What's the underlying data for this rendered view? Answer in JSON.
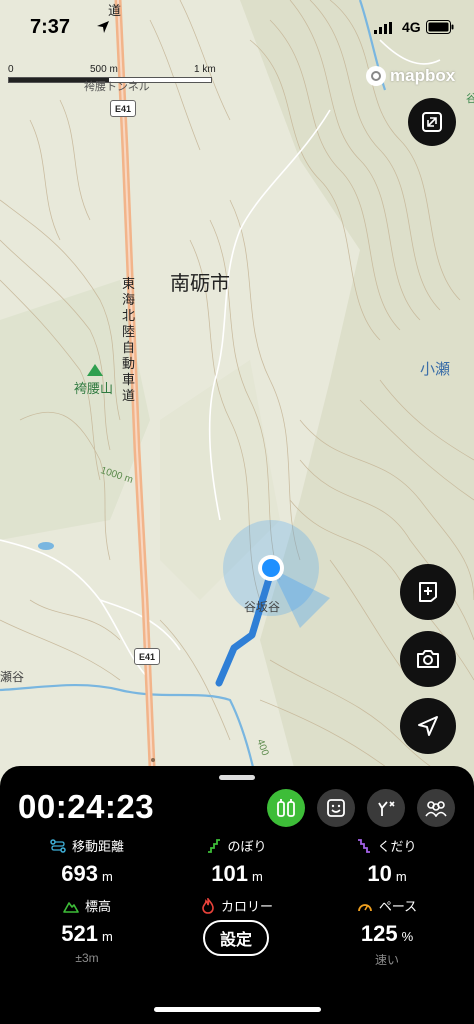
{
  "status_bar": {
    "time": "7:37",
    "network": "4G"
  },
  "map": {
    "scale_labels": [
      "0",
      "500 m",
      "1 km"
    ],
    "attribution": "mapbox",
    "places": {
      "city": "南砺市",
      "expressway_name": "東海北陸自動車道",
      "mountain": "袴腰山",
      "tunnel": "袴腰トンネル",
      "route_top": "道",
      "kose": "小瀬",
      "valley": "谷",
      "valley_label": "谷坂谷",
      "settlement_left": "瀬谷"
    },
    "road_shields": [
      "E41",
      "E41"
    ],
    "contour_labels": [
      "1000 m",
      "400"
    ]
  },
  "tracker": {
    "elapsed": "00:24:23",
    "modes": [
      "hiking-mode",
      "face-mode",
      "route-mode",
      "group-mode"
    ],
    "active_mode": "hiking-mode",
    "stats": {
      "distance": {
        "label": "移動距離",
        "value": "693",
        "unit": "m"
      },
      "ascent": {
        "label": "のぼり",
        "value": "101",
        "unit": "m"
      },
      "descent": {
        "label": "くだり",
        "value": "10",
        "unit": "m"
      },
      "elevation": {
        "label": "標高",
        "value": "521",
        "unit": "m",
        "sub": "±3m"
      },
      "calories": {
        "label": "カロリー"
      },
      "pace": {
        "label": "ペース",
        "value": "125",
        "unit": "%",
        "sub": "速い"
      }
    },
    "settings_label": "設定"
  },
  "colors": {
    "accent_green": "#3dbd38",
    "location_blue": "#1e90ff",
    "track_blue": "#2f7fd6",
    "expressway": "#f2b48a"
  }
}
